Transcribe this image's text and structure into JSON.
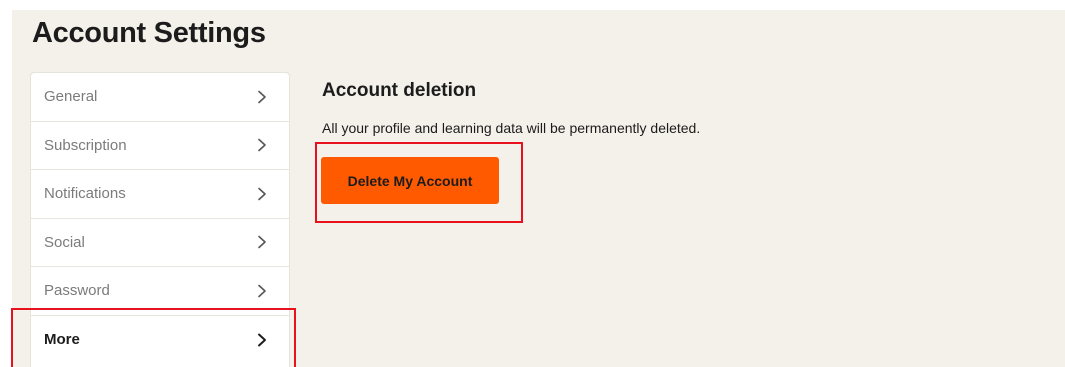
{
  "page": {
    "title": "Account Settings"
  },
  "sidebar": {
    "items": [
      {
        "label": "General",
        "icon": "chevron-right-icon",
        "active": false
      },
      {
        "label": "Subscription",
        "icon": "chevron-right-icon",
        "active": false
      },
      {
        "label": "Notifications",
        "icon": "chevron-right-icon",
        "active": false
      },
      {
        "label": "Social",
        "icon": "chevron-right-icon",
        "active": false
      },
      {
        "label": "Password",
        "icon": "chevron-right-icon",
        "active": false
      },
      {
        "label": "More",
        "icon": "chevron-right-icon",
        "active": true
      }
    ]
  },
  "content": {
    "title": "Account deletion",
    "description": "All your profile and learning data will be permanently deleted.",
    "delete_button_label": "Delete My Account"
  },
  "colors": {
    "background": "#f4f0ea",
    "accent": "#ff5a00",
    "highlight": "#e8121e",
    "text_primary": "#1c1c1c",
    "text_muted": "#7b7b7b"
  }
}
